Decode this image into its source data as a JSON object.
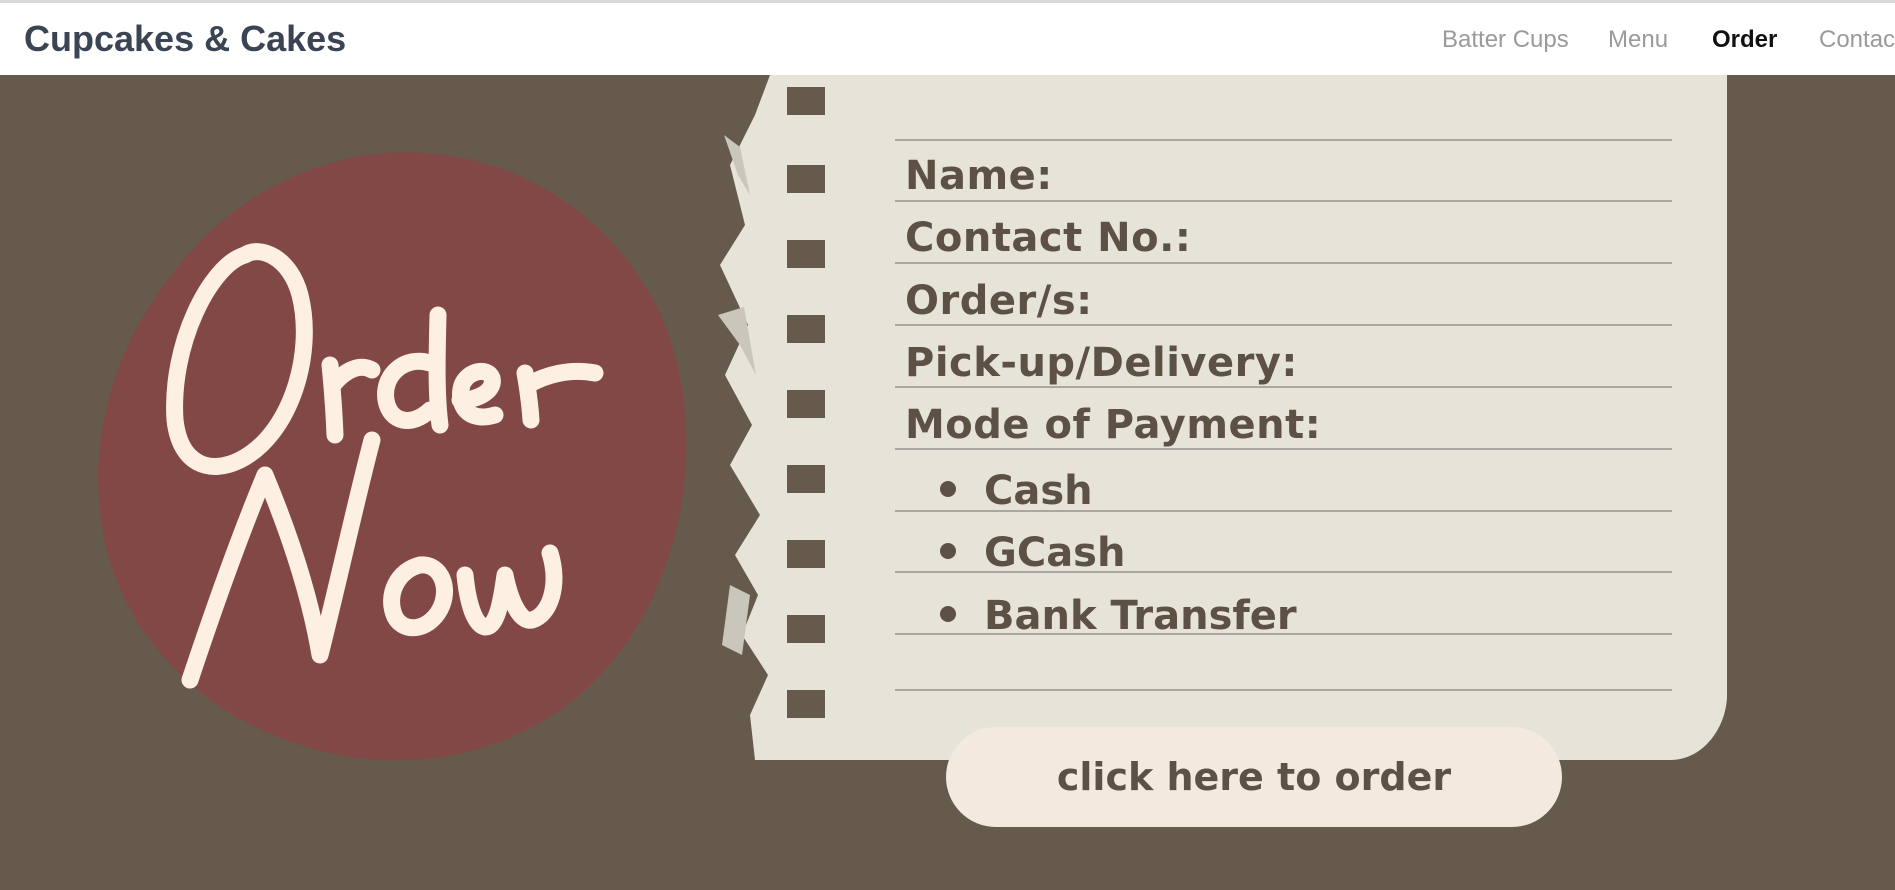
{
  "navbar": {
    "brand": "Cupcakes & Cakes",
    "links": [
      {
        "label": "Batter Cups",
        "active": false
      },
      {
        "label": "Menu",
        "active": false
      },
      {
        "label": "Order",
        "active": true
      },
      {
        "label": "Contact",
        "active": false
      }
    ]
  },
  "hero": {
    "headline": "Order Now",
    "form_fields": [
      "Name:",
      "Contact No.:",
      "Order/s:",
      "Pick-up/Delivery:",
      "Mode of Payment:"
    ],
    "payment_options": [
      "Cash",
      "GCash",
      "Bank Transfer"
    ],
    "order_button_label": "click here to order"
  },
  "colors": {
    "background": "#665a4d",
    "blob": "#824846",
    "headline_script": "#fdf0e2",
    "paper": "#e6e4d9",
    "ink": "#5d5146",
    "button": "#f3e9df"
  }
}
